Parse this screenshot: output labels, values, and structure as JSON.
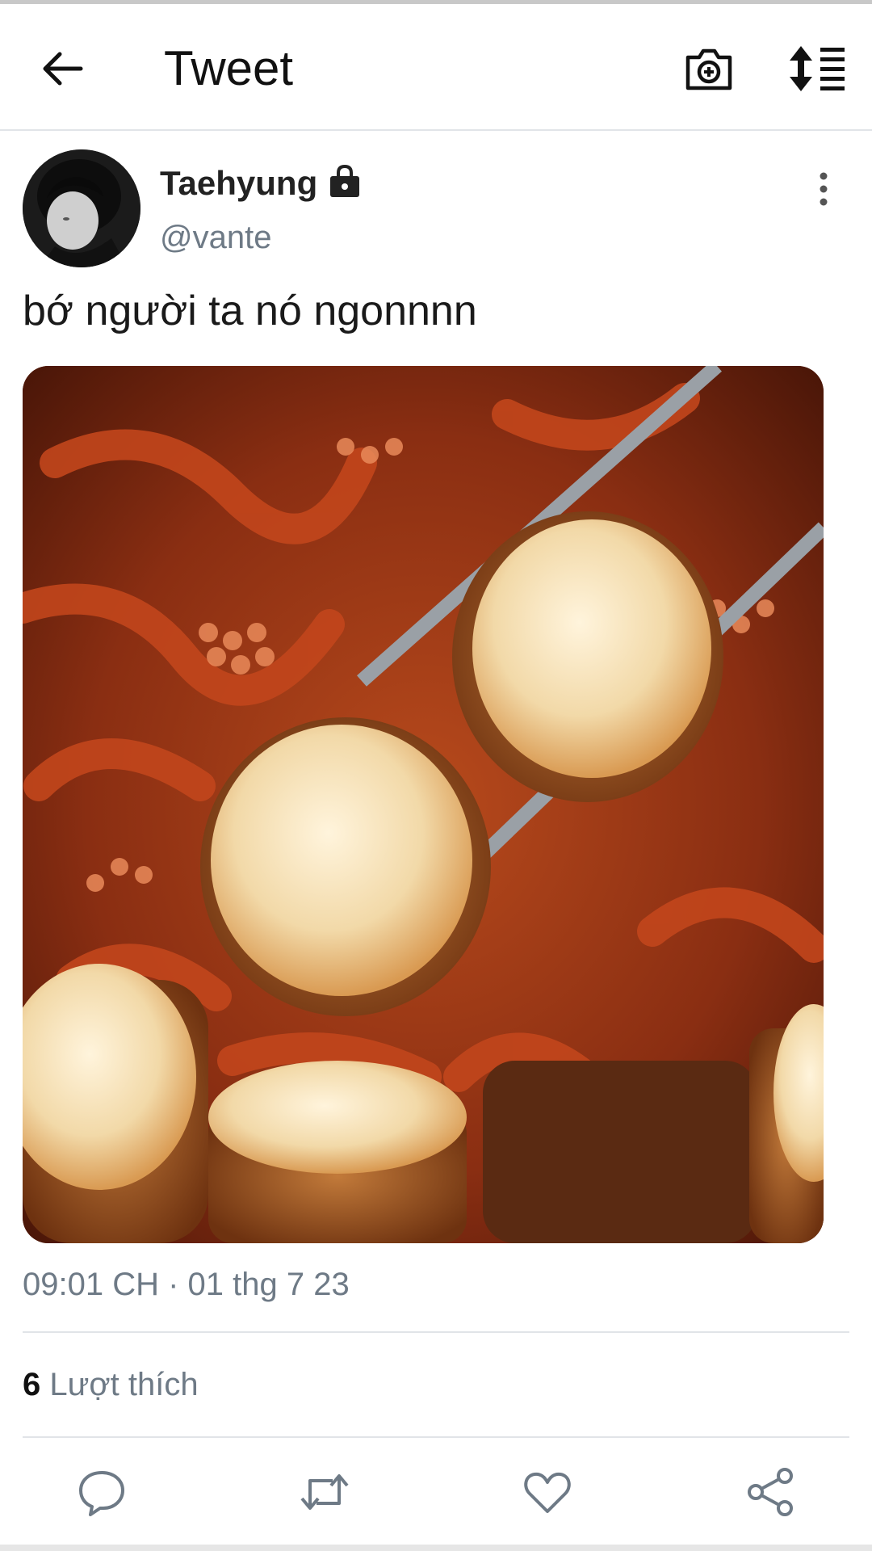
{
  "header": {
    "title": "Tweet",
    "back_icon": "arrow-left-icon",
    "camera_icon": "camera-plus-icon",
    "sort_icon": "sort-list-icon"
  },
  "tweet": {
    "display_name": "Taehyung",
    "handle": "@vante",
    "protected_icon": "lock-icon",
    "text": "bớ người ta nó ngonnnn",
    "media_description_icon": "photo-octopus-rice-rolls",
    "timestamp": "09:01 CH · 01 thg 7 23",
    "likes_count": "6",
    "likes_label": "Lượt thích"
  },
  "actions": {
    "reply_icon": "reply-icon",
    "retweet_icon": "retweet-icon",
    "like_icon": "heart-icon",
    "share_icon": "share-icon"
  },
  "colors": {
    "secondary_text": "#6e7a86",
    "divider": "#e1e4e8",
    "primary_text": "#0f1419"
  }
}
